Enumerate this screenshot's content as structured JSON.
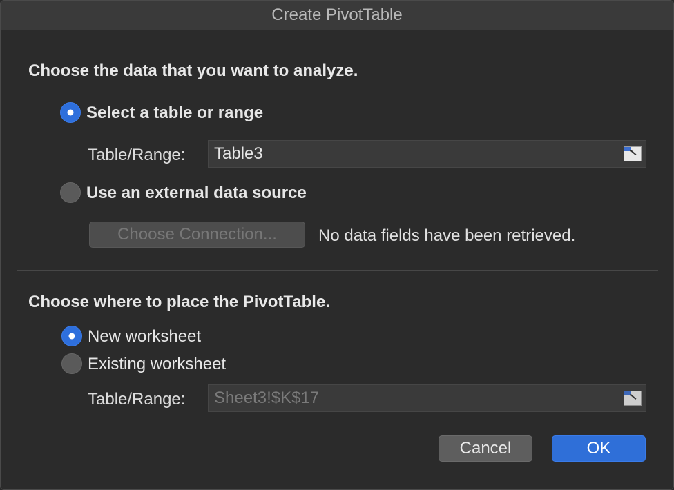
{
  "window": {
    "title": "Create PivotTable"
  },
  "data_section": {
    "heading": "Choose the data that you want to analyze.",
    "option_table": {
      "label": "Select a table or range",
      "selected": true
    },
    "table_range": {
      "label": "Table/Range:",
      "value": "Table3"
    },
    "option_external": {
      "label": "Use an external data source",
      "selected": false
    },
    "choose_connection_label": "Choose Connection...",
    "status_text": "No data fields have been retrieved."
  },
  "place_section": {
    "heading": "Choose where to place the PivotTable.",
    "option_new": {
      "label": "New worksheet",
      "selected": true
    },
    "option_existing": {
      "label": "Existing worksheet",
      "selected": false
    },
    "table_range": {
      "label": "Table/Range:",
      "value": "Sheet3!$K$17"
    }
  },
  "buttons": {
    "cancel_label": "Cancel",
    "ok_label": "OK"
  },
  "icons": {
    "collapse_range": "collapse-range-icon"
  },
  "colors": {
    "accent": "#2f6fd8",
    "background": "#2b2b2b"
  }
}
